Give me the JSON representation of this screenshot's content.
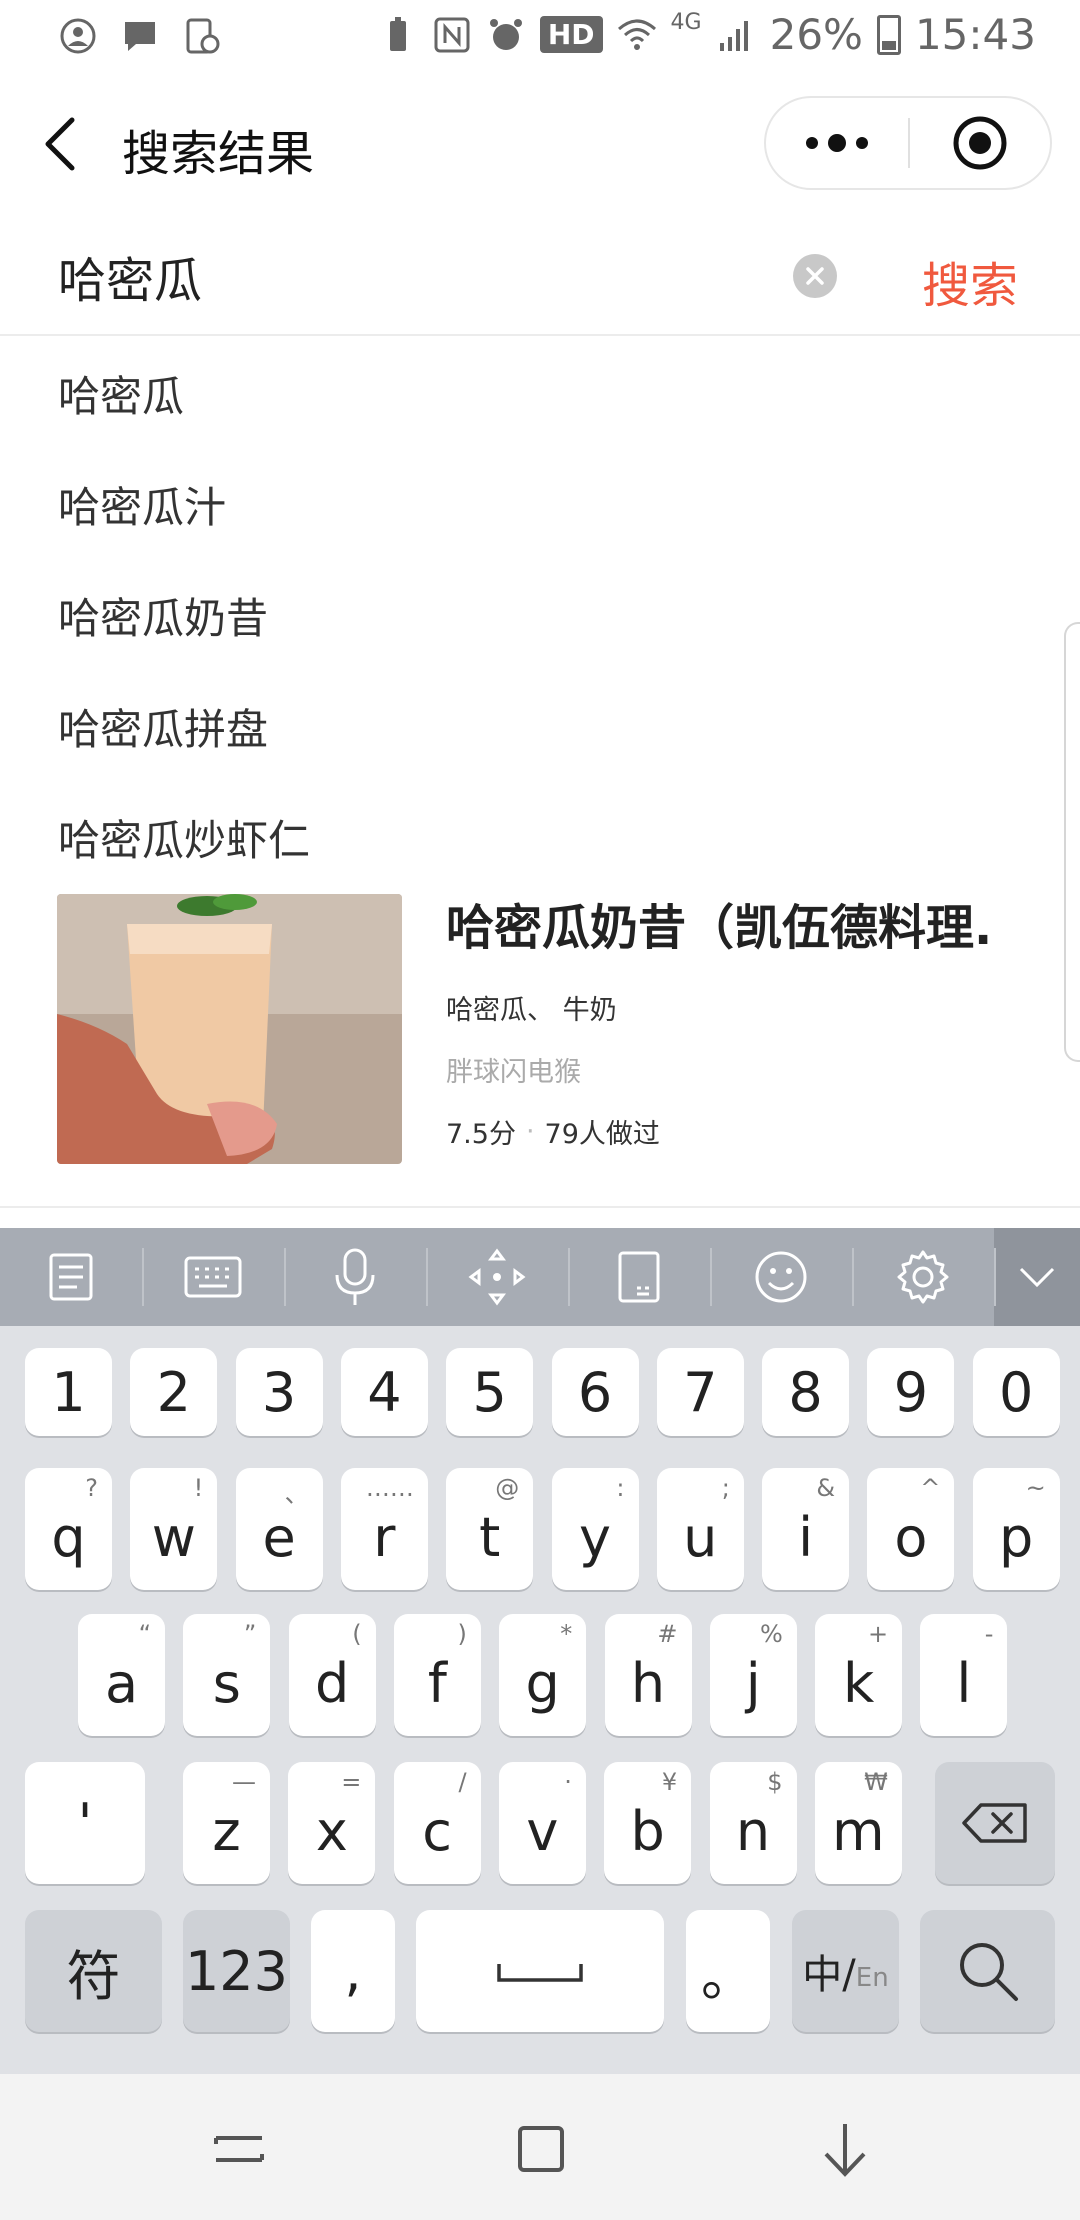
{
  "status_bar": {
    "hd": "HD",
    "network": "4G",
    "battery": "26%",
    "time": "15:43"
  },
  "nav": {
    "title": "搜索结果"
  },
  "search": {
    "query": "哈密瓜",
    "button": "搜索"
  },
  "suggestions": [
    "哈密瓜",
    "哈密瓜汁",
    "哈密瓜奶昔",
    "哈密瓜拼盘",
    "哈密瓜炒虾仁"
  ],
  "result": {
    "title": "哈密瓜奶昔（凯伍德料理.",
    "ingredients": "哈密瓜、 牛奶",
    "author": "胖球闪电猴",
    "score": "7.5分",
    "made": "79人做过"
  },
  "keyboard": {
    "row_numbers": [
      "1",
      "2",
      "3",
      "4",
      "5",
      "6",
      "7",
      "8",
      "9",
      "0"
    ],
    "row1": [
      [
        "q",
        "?"
      ],
      [
        "w",
        "!"
      ],
      [
        "e",
        "、"
      ],
      [
        "r",
        "……"
      ],
      [
        "t",
        "@"
      ],
      [
        "y",
        ":"
      ],
      [
        "u",
        ";"
      ],
      [
        "i",
        "&"
      ],
      [
        "o",
        "^"
      ],
      [
        "p",
        "~"
      ]
    ],
    "row2": [
      [
        "a",
        "“"
      ],
      [
        "s",
        "”"
      ],
      [
        "d",
        "("
      ],
      [
        "f",
        ")"
      ],
      [
        "g",
        "*"
      ],
      [
        "h",
        "#"
      ],
      [
        "j",
        "%"
      ],
      [
        "k",
        "+"
      ],
      [
        "l",
        "-"
      ]
    ],
    "row3": [
      [
        "z",
        "—"
      ],
      [
        "x",
        "="
      ],
      [
        "c",
        "/"
      ],
      [
        "v",
        "·"
      ],
      [
        "b",
        "¥"
      ],
      [
        "n",
        "$"
      ],
      [
        "m",
        "₩"
      ]
    ],
    "apostrophe": "'",
    "symbols": "符",
    "numbers": "123",
    "comma": ",",
    "period": "。",
    "lang_zh": "中/",
    "lang_en": "En"
  }
}
